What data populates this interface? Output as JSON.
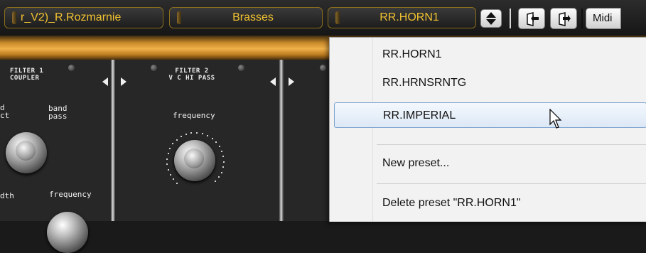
{
  "toolbar": {
    "bank_label": "r_V2)_R.Rozmarnie",
    "category_label": "Brasses",
    "preset_label": "RR.HORN1",
    "midi_label": "Midi",
    "colors": {
      "pill_text": "#f2c230",
      "pill_border": "#8a6d1c"
    }
  },
  "modules": {
    "filter1": {
      "title_line1": "FILTER 1",
      "title_line2": "COUPLER",
      "knob_labels": {
        "band_reject": "d\nct",
        "band_pass": "band\npass",
        "width": "dth",
        "frequency": "frequency"
      }
    },
    "filter2": {
      "title_line1": "FILTER 2",
      "title_line2": "V C HI PASS",
      "knob_labels": {
        "frequency": "frequency"
      }
    }
  },
  "preset_menu": {
    "items": [
      {
        "label": "RR.HORN1",
        "selected": false
      },
      {
        "label": "RR.HRNSRNTG",
        "selected": false
      },
      {
        "label": "RR.IMPERIAL",
        "selected": true
      }
    ],
    "actions": [
      {
        "label": "New preset..."
      },
      {
        "label": "Delete preset \"RR.HORN1\""
      }
    ]
  }
}
